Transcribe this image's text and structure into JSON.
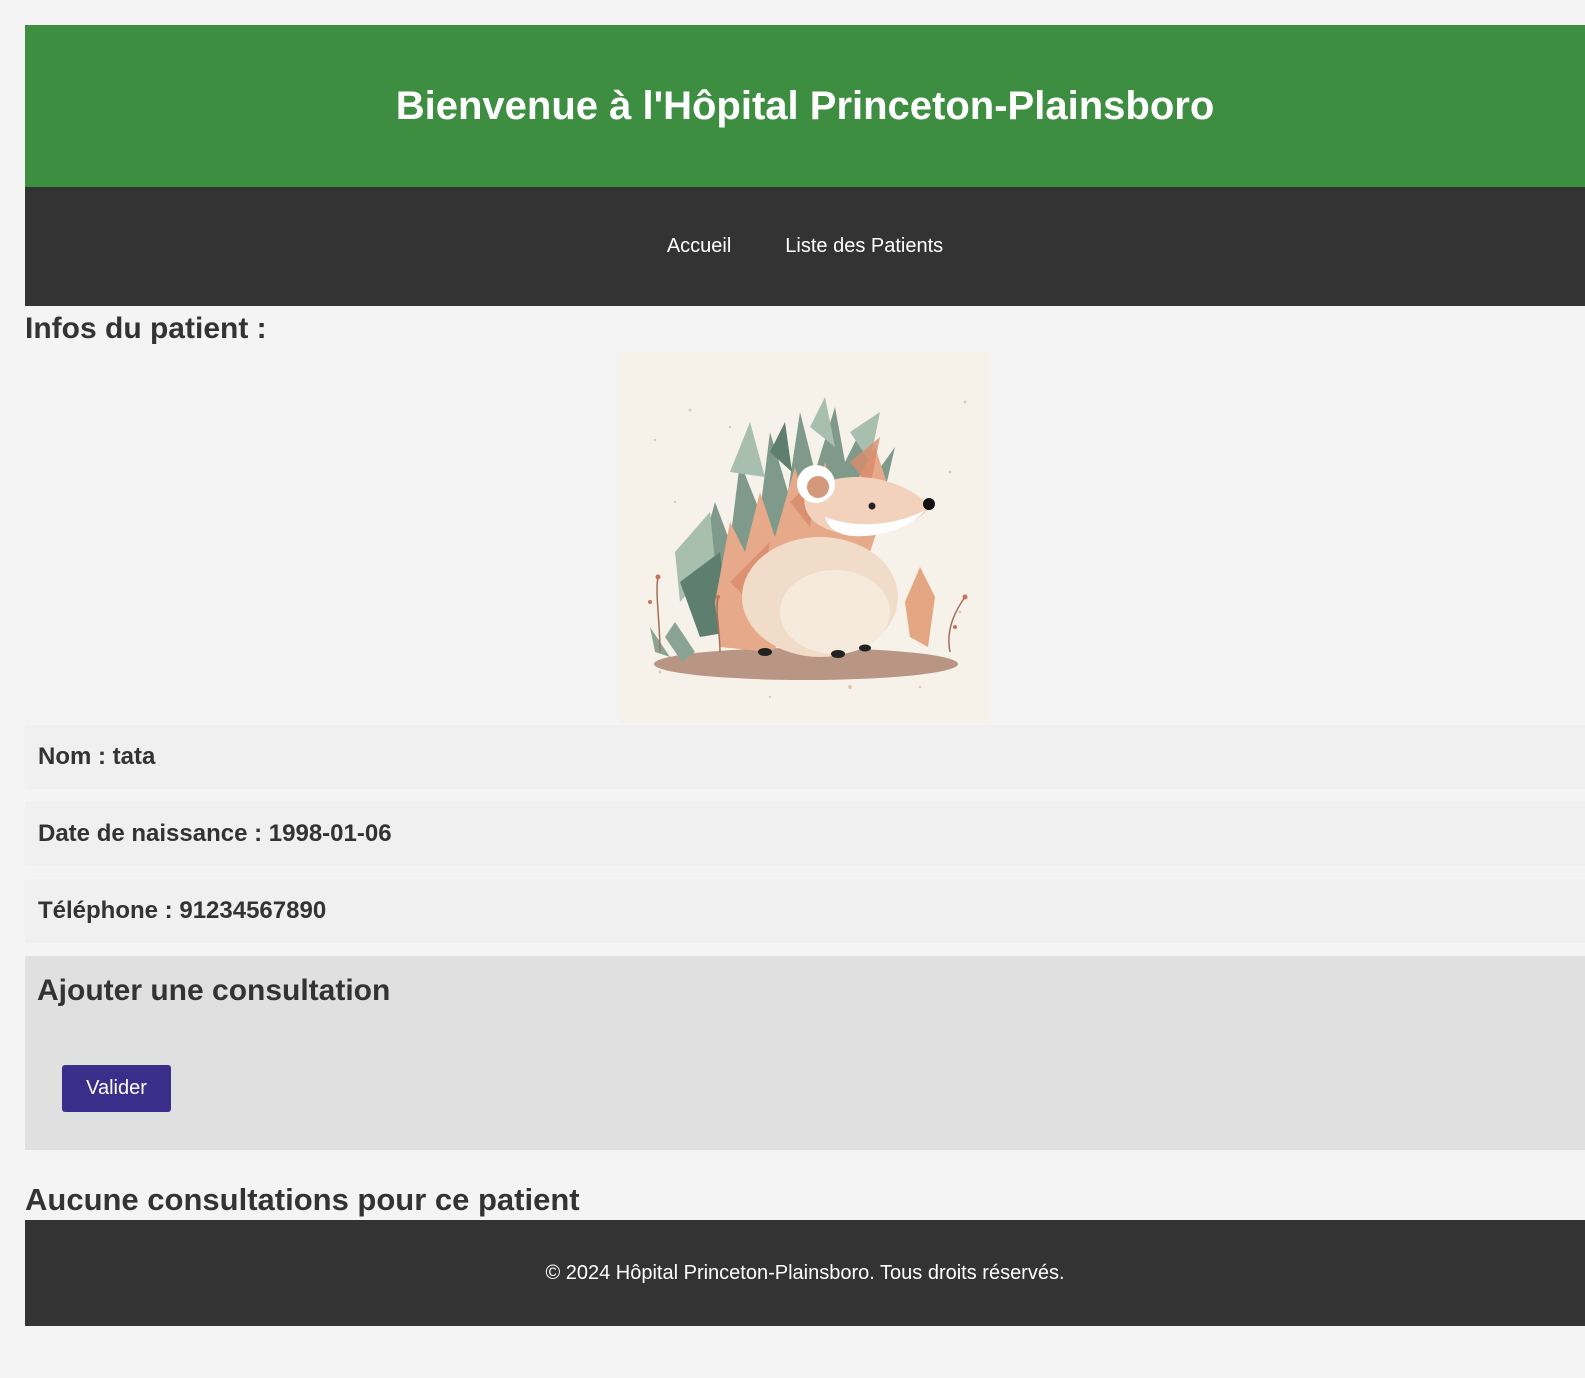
{
  "header": {
    "title": "Bienvenue à l'Hôpital Princeton-Plainsboro"
  },
  "nav": {
    "items": [
      {
        "label": "Accueil"
      },
      {
        "label": "Liste des Patients"
      }
    ]
  },
  "patient": {
    "section_title": "Infos du patient :",
    "photo_icon": "hedgehog-illustration",
    "name_label": "Nom :",
    "name_value": "tata",
    "birth_label": "Date de naissance :",
    "birth_value": "1998-01-06",
    "phone_label": "Téléphone :",
    "phone_value": "91234567890"
  },
  "consultation": {
    "title": "Ajouter une consultation",
    "submit_label": "Valider",
    "empty_message": "Aucune consultations pour ce patient"
  },
  "footer": {
    "text": "© 2024 Hôpital Princeton-Plainsboro. Tous droits réservés."
  },
  "colors": {
    "header_bg": "#3e8e41",
    "nav_bg": "#333333",
    "button_bg": "#3a2e8a",
    "page_bg": "#f4f4f4"
  }
}
